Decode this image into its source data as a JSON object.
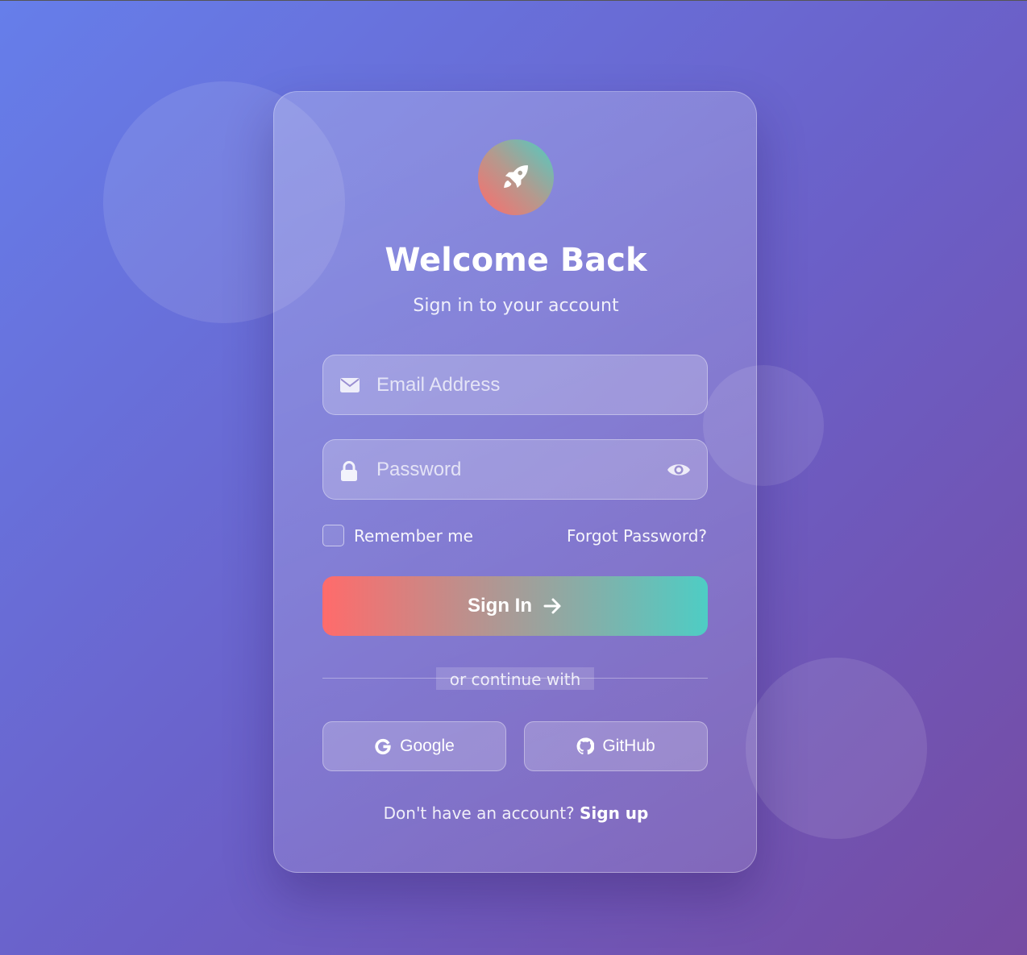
{
  "header": {
    "title": "Welcome Back",
    "subtitle": "Sign in to your account",
    "logo_icon": "rocket-icon"
  },
  "form": {
    "email": {
      "placeholder": "Email Address",
      "value": "",
      "icon": "envelope-icon"
    },
    "password": {
      "placeholder": "Password",
      "value": "",
      "icon": "lock-icon",
      "toggle_icon": "eye-icon"
    },
    "remember_label": "Remember me",
    "remember_checked": false,
    "forgot_label": "Forgot Password?",
    "submit_label": "Sign In",
    "submit_icon": "arrow-right-icon"
  },
  "divider": {
    "label": "or continue with"
  },
  "social": [
    {
      "label": "Google",
      "icon": "google-icon"
    },
    {
      "label": "GitHub",
      "icon": "github-icon"
    }
  ],
  "footer": {
    "prompt": "Don't have an account?",
    "link": "Sign up"
  },
  "colors": {
    "bg_start": "#667eea",
    "bg_end": "#764ba2",
    "accent_start": "#ff6b6b",
    "accent_end": "#4ecdc4"
  }
}
